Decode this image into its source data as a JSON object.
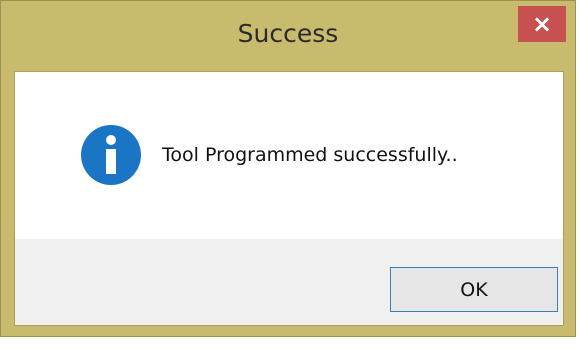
{
  "dialog": {
    "title": "Success",
    "close_label": "×",
    "message": "Tool Programmed successfully..",
    "icon": "info-icon",
    "ok_label": "OK"
  },
  "colors": {
    "frame": "#c9bb6e",
    "close_button": "#c75050",
    "info_icon": "#1a76c5",
    "button_area": "#f0f0f0",
    "ok_border": "#3c7fb1"
  }
}
